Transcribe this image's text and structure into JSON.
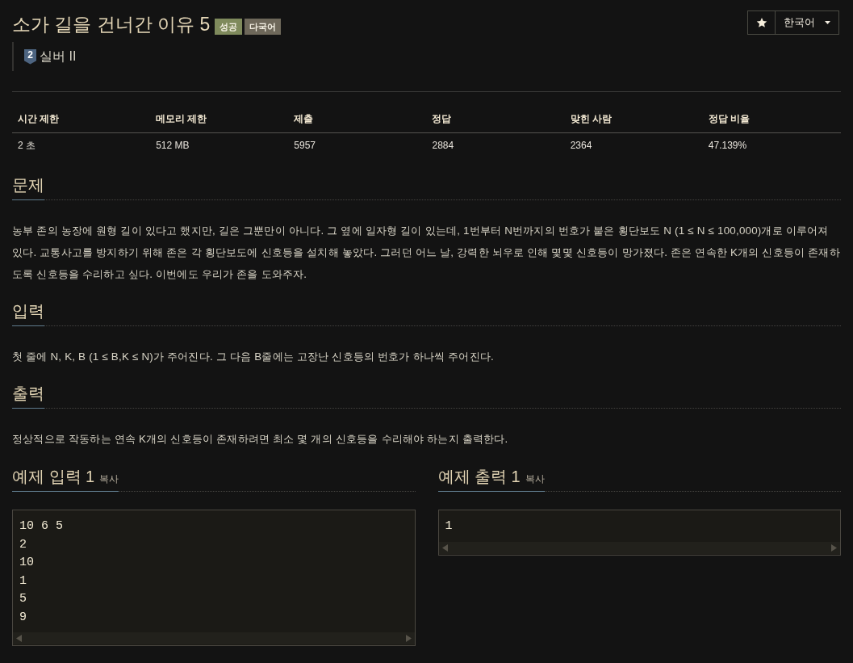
{
  "problem_header": {
    "title": "소가 길을 건너간 이유 5",
    "badges": [
      {
        "label": "성공",
        "color": "#7f8a5c"
      },
      {
        "label": "다국어",
        "color": "#6e685a"
      }
    ],
    "tier": {
      "number": "2",
      "label": "실버 II"
    }
  },
  "toolbar": {
    "language": "한국어"
  },
  "info_table": {
    "columns": [
      "시간 제한",
      "메모리 제한",
      "제출",
      "정답",
      "맞힌 사람",
      "정답 비율"
    ],
    "rows": [
      [
        "2 초",
        "512 MB",
        "5957",
        "2884",
        "2364",
        "47.139%"
      ]
    ]
  },
  "sections": [
    {
      "heading": "문제",
      "text": "농부 존의 농장에 원형 길이 있다고 했지만, 길은 그뿐만이 아니다. 그 옆에 일자형 길이 있는데, 1번부터 N번까지의 번호가 붙은 횡단보도 N (1 ≤ N ≤ 100,000)개로 이루어져 있다. 교통사고를 방지하기 위해 존은 각 횡단보도에 신호등을 설치해 놓았다. 그러던 어느 날, 강력한 뇌우로 인해 몇몇 신호등이 망가졌다. 존은 연속한 K개의 신호등이 존재하도록 신호등을 수리하고 싶다. 이번에도 우리가 존을 도와주자."
    },
    {
      "heading": "입력",
      "text": "첫 줄에 N, K, B (1 ≤ B,K ≤ N)가 주어진다. 그 다음 B줄에는 고장난 신호등의 번호가 하나씩 주어진다."
    },
    {
      "heading": "출력",
      "text": "정상적으로 작동하는 연속 K개의 신호등이 존재하려면 최소 몇 개의 신호등을 수리해야 하는지 출력한다."
    }
  ],
  "samples": [
    {
      "heading": "예제 입력 1",
      "copy_label": "복사",
      "lines": [
        "10 6 5",
        "2",
        "10",
        "1",
        "5",
        "9"
      ]
    },
    {
      "heading": "예제 출력 1",
      "copy_label": "복사",
      "lines": [
        "1"
      ]
    }
  ]
}
